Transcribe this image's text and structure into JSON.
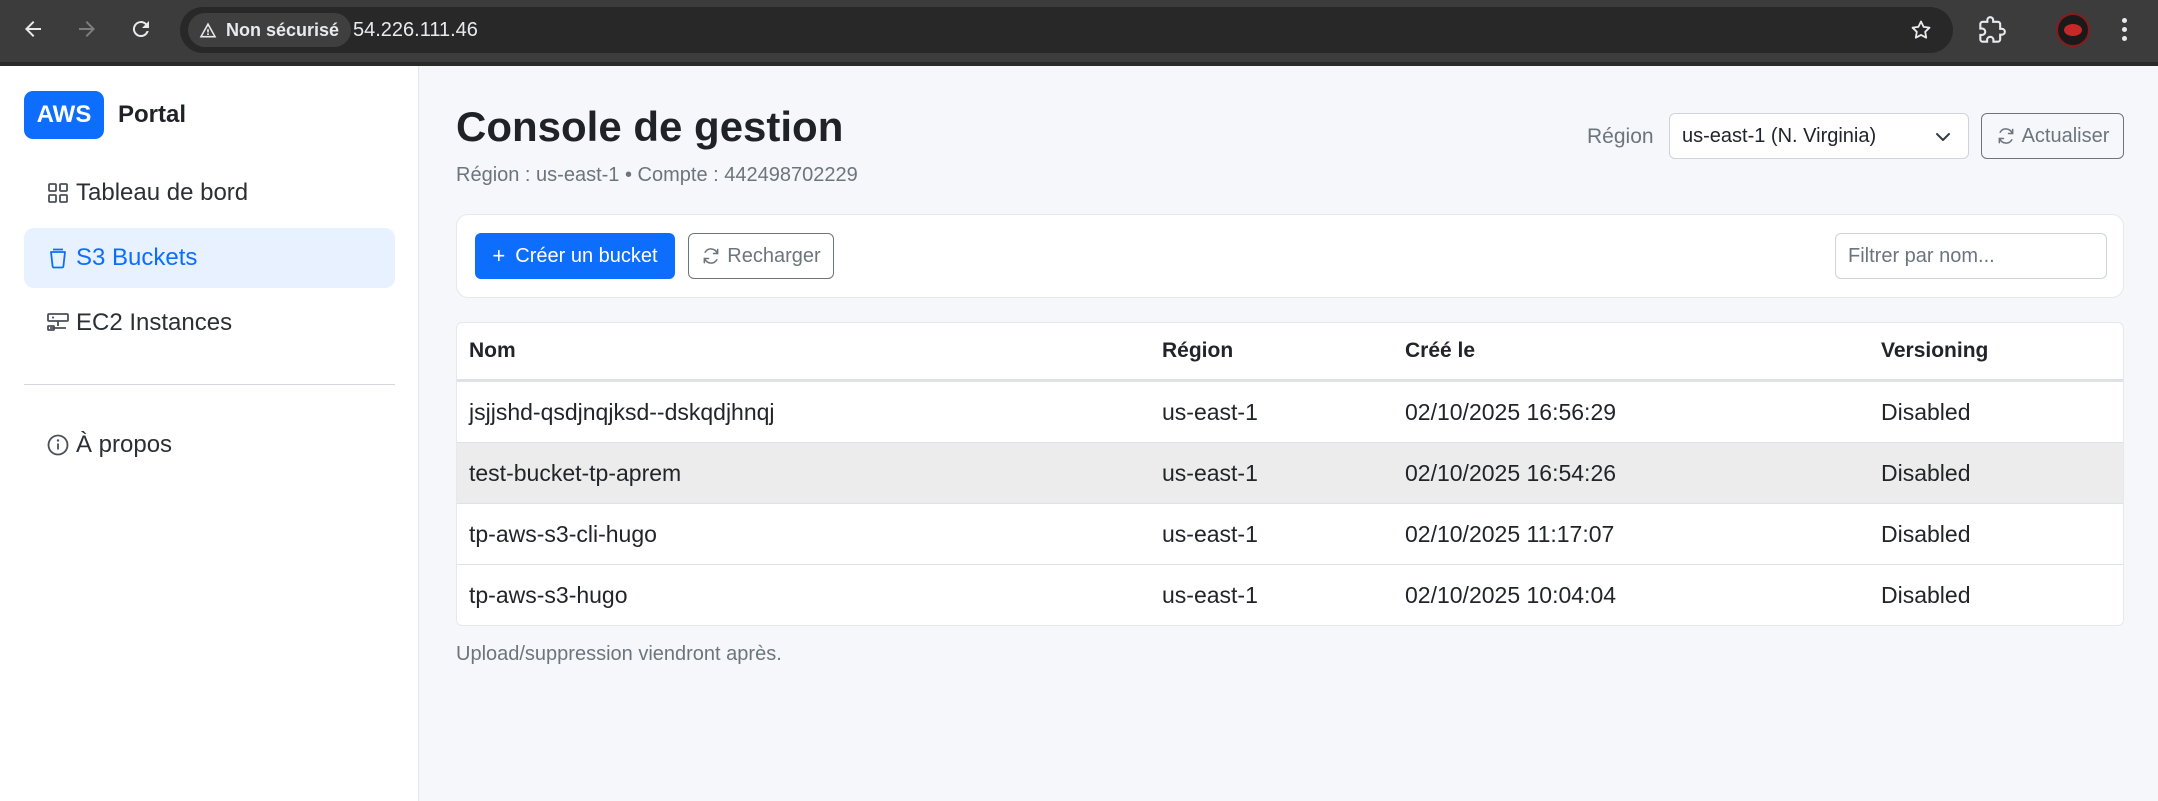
{
  "browser": {
    "security_label": "Non sécurisé",
    "url": "54.226.111.46"
  },
  "sidebar": {
    "brand_badge": "AWS",
    "brand_name": "Portal",
    "items": [
      {
        "label": "Tableau de bord",
        "icon": "grid-icon",
        "active": false
      },
      {
        "label": "S3 Buckets",
        "icon": "bucket-icon",
        "active": true
      },
      {
        "label": "EC2 Instances",
        "icon": "server-icon",
        "active": false
      }
    ],
    "about": {
      "label": "À propos",
      "icon": "info-icon"
    }
  },
  "header": {
    "title": "Console de gestion",
    "subtitle": "Région : us-east-1 • Compte : 442498702229",
    "region_label": "Région",
    "region_selected": "us-east-1 (N. Virginia)",
    "refresh_label": "Actualiser"
  },
  "toolbar": {
    "create_label": "Créer un bucket",
    "reload_label": "Recharger",
    "filter_placeholder": "Filtrer par nom..."
  },
  "table": {
    "columns": [
      "Nom",
      "Région",
      "Créé le",
      "Versioning"
    ],
    "rows": [
      [
        "jsjjshd-qsdjnqjksd--dskqdjhnqj",
        "us-east-1",
        "02/10/2025 16:56:29",
        "Disabled"
      ],
      [
        "test-bucket-tp-aprem",
        "us-east-1",
        "02/10/2025 16:54:26",
        "Disabled"
      ],
      [
        "tp-aws-s3-cli-hugo",
        "us-east-1",
        "02/10/2025 11:17:07",
        "Disabled"
      ],
      [
        "tp-aws-s3-hugo",
        "us-east-1",
        "02/10/2025 10:04:04",
        "Disabled"
      ]
    ]
  },
  "footnote": "Upload/suppression viendront après.",
  "colors": {
    "accent": "#0d6efd",
    "active_bg": "#e7f1ff",
    "chrome": "#3c3c3c"
  }
}
